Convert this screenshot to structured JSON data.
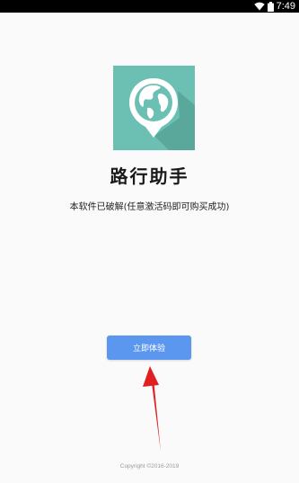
{
  "status_bar": {
    "time": "7:49",
    "icons": [
      "wifi-icon",
      "battery-icon"
    ]
  },
  "app": {
    "logo_icon": "globe-map-pin-icon",
    "logo_colors": {
      "background": "#6cc0b3",
      "accent": "#ffffff",
      "shadow": "#5aa89c"
    },
    "name": "路行助手",
    "note": "本软件已破解(任意激活码即可购买成功)"
  },
  "actions": {
    "start_label": "立即体验",
    "start_color": "#5b97ef"
  },
  "annotation": {
    "arrow_color": "#e02020"
  },
  "footer": {
    "copyright": "Copyright ©2016-2019"
  }
}
